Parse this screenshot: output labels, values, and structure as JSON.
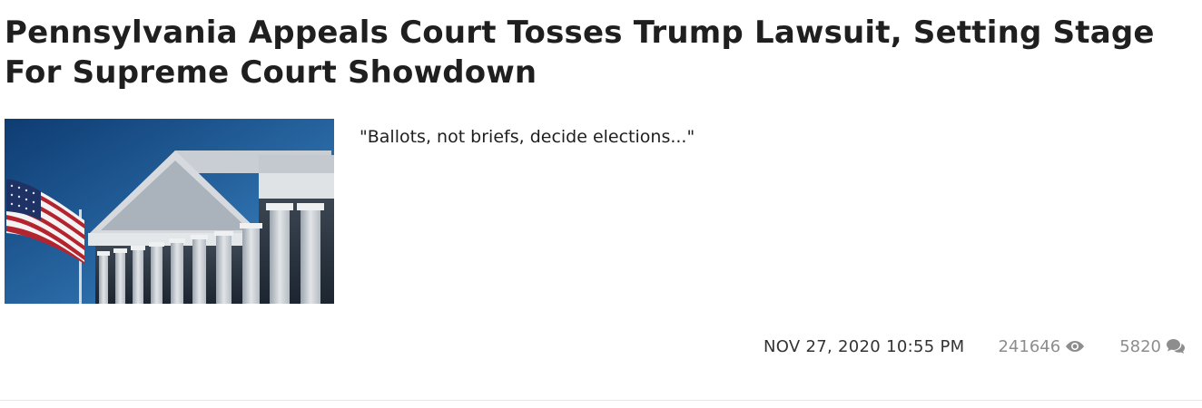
{
  "article": {
    "headline": "Pennsylvania Appeals Court Tosses Trump Lawsuit, Setting Stage For Supreme Court Showdown",
    "teaser": "\"Ballots, not briefs, decide elections...\"",
    "image_icon": "supreme-court-building-with-us-flag-photo",
    "meta": {
      "date": "NOV 27, 2020 10:55 PM",
      "views": "241646",
      "views_icon": "eye-icon",
      "comments": "5820",
      "comments_icon": "comments-icon"
    }
  },
  "colors": {
    "text": "#1f1f1f",
    "meta_gray": "#8d8d8d",
    "sky": "#1c4f86"
  }
}
